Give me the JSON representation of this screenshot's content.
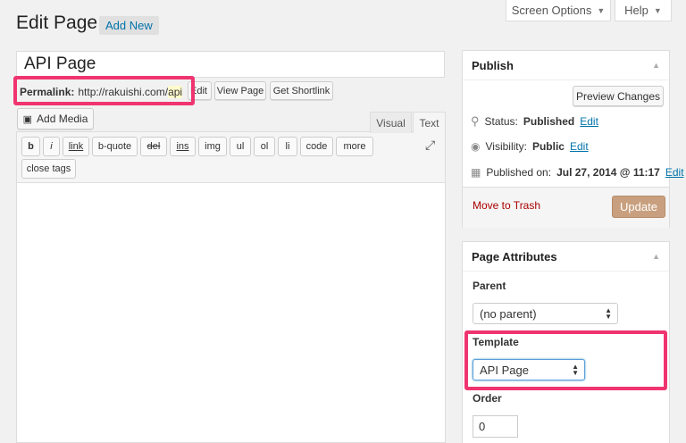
{
  "header": {
    "screen_options": "Screen Options",
    "help": "Help",
    "title": "Edit Page",
    "add_new": "Add New"
  },
  "post": {
    "title": "API Page",
    "permalink_label": "Permalink:",
    "permalink_base": "http://rakuishi.com/",
    "permalink_slug": "api",
    "edit_label": "Edit",
    "view_page": "View Page",
    "get_shortlink": "Get Shortlink"
  },
  "editor": {
    "add_media": "Add Media",
    "tab_visual": "Visual",
    "tab_text": "Text",
    "quicktags": [
      "b",
      "i",
      "link",
      "b-quote",
      "del",
      "ins",
      "img",
      "ul",
      "ol",
      "li",
      "code",
      "more"
    ],
    "close_tags": "close tags",
    "content": ""
  },
  "publish": {
    "title": "Publish",
    "preview": "Preview Changes",
    "status_label": "Status:",
    "status_value": "Published",
    "visibility_label": "Visibility:",
    "visibility_value": "Public",
    "published_label": "Published on:",
    "published_value": "Jul 27, 2014 @ 11:17",
    "edit_link": "Edit",
    "trash": "Move to Trash",
    "update": "Update"
  },
  "page_attributes": {
    "title": "Page Attributes",
    "parent_label": "Parent",
    "parent_value": "(no parent)",
    "template_label": "Template",
    "template_value": "API Page",
    "order_label": "Order",
    "order_value": "0"
  },
  "colors": {
    "highlight": "#f0346f",
    "link": "#0073aa",
    "update_button": "#c9a07f",
    "trash": "#a00"
  },
  "icons": {
    "status": "pin-icon",
    "visibility": "eye-icon",
    "published": "calendar-icon",
    "fullscreen": "expand-icon",
    "add_media": "media-icon"
  }
}
